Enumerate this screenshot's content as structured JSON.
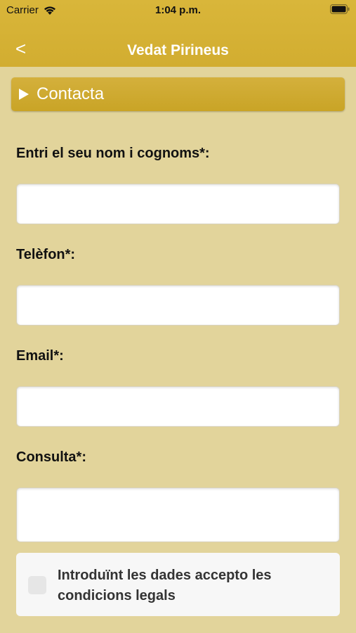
{
  "status_bar": {
    "carrier": "Carrier",
    "time": "1:04 p.m."
  },
  "nav": {
    "back_label": "<",
    "title": "Vedat Pirineus"
  },
  "section": {
    "title": "Contacta"
  },
  "form": {
    "name_label": "Entri el seu nom i cognoms*:",
    "phone_label": "Telèfon*:",
    "email_label": "Email*:",
    "query_label": "Consulta*:",
    "terms_text": "Introduïnt les dades accepto les condicions legals"
  },
  "colors": {
    "header": "#d4b034",
    "background": "#e2d49b",
    "section_bar": "#cda92e"
  }
}
